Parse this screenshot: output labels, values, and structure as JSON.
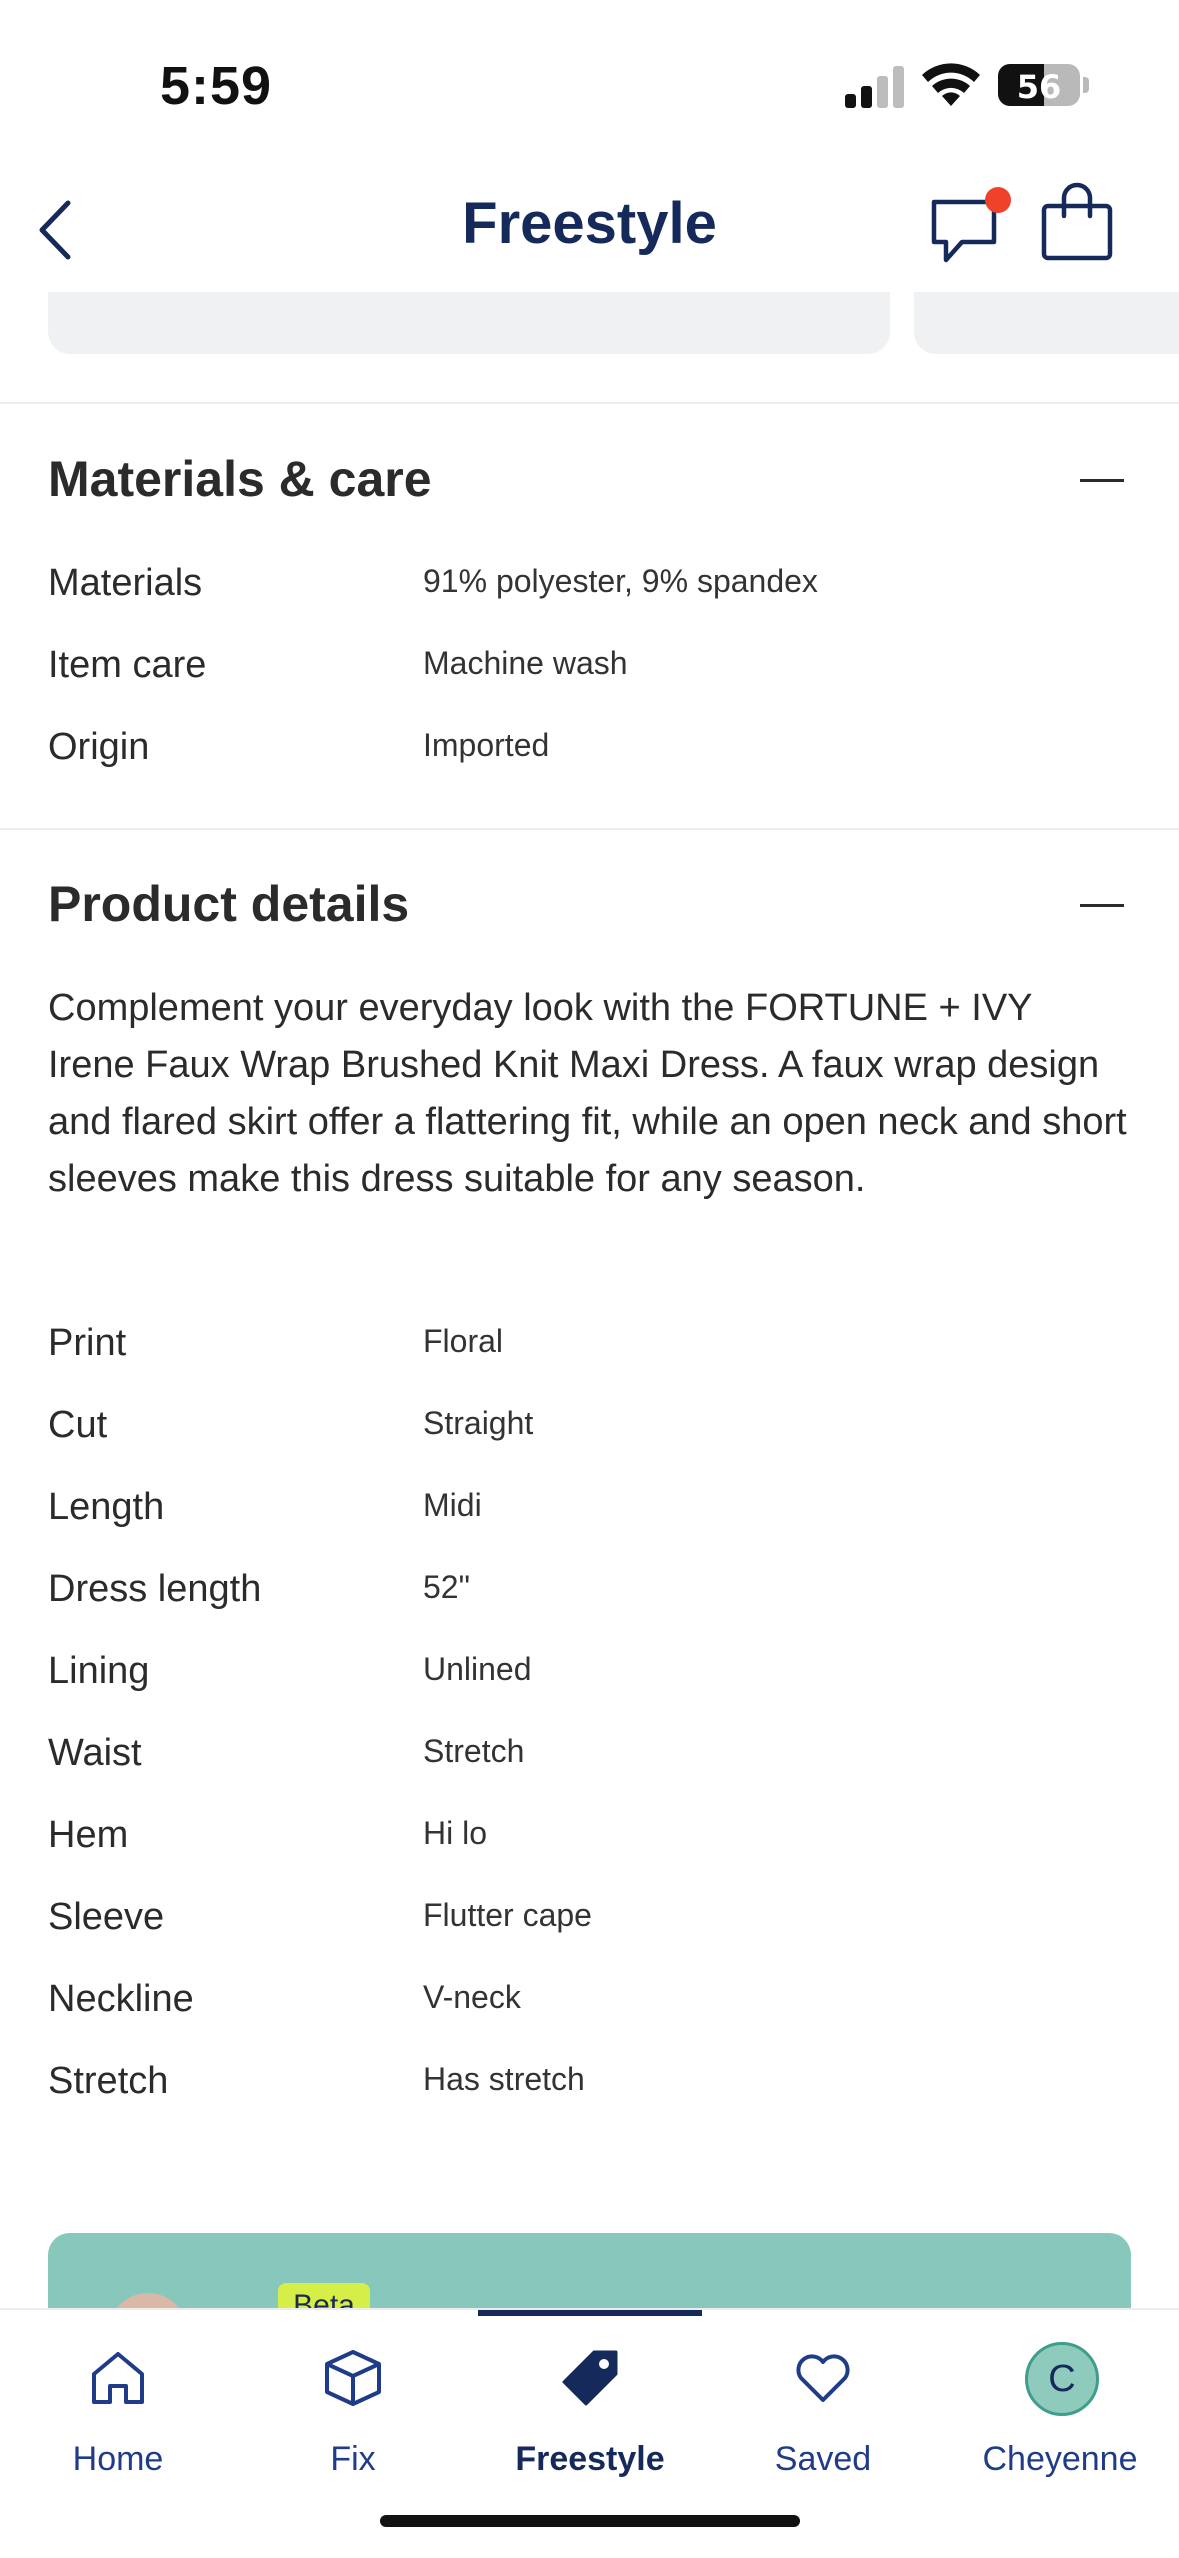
{
  "status_bar": {
    "time": "5:59",
    "battery": "56",
    "battery_level": 0.56
  },
  "header": {
    "title": "Freestyle"
  },
  "materials": {
    "title": "Materials & care",
    "rows": [
      {
        "label": "Materials",
        "value": "91% polyester, 9% spandex"
      },
      {
        "label": "Item care",
        "value": "Machine wash"
      },
      {
        "label": "Origin",
        "value": "Imported"
      }
    ]
  },
  "product_details": {
    "title": "Product details",
    "description": "Complement your everyday look with the FORTUNE + IVY Irene Faux Wrap Brushed Knit Maxi Dress. A faux wrap design and flared skirt offer a flattering fit, while an open neck and short sleeves make this dress suitable for any season.",
    "rows": [
      {
        "label": "Print",
        "value": "Floral"
      },
      {
        "label": "Cut",
        "value": "Straight"
      },
      {
        "label": "Length",
        "value": "Midi"
      },
      {
        "label": "Dress length",
        "value": "52\""
      },
      {
        "label": "Lining",
        "value": "Unlined"
      },
      {
        "label": "Waist",
        "value": "Stretch"
      },
      {
        "label": "Hem",
        "value": "Hi lo"
      },
      {
        "label": "Sleeve",
        "value": "Flutter cape"
      },
      {
        "label": "Neckline",
        "value": "V-neck"
      },
      {
        "label": "Stretch",
        "value": "Has stretch"
      }
    ]
  },
  "promo": {
    "badge": "Beta"
  },
  "nav": {
    "items": [
      {
        "label": "Home",
        "icon": "home-icon"
      },
      {
        "label": "Fix",
        "icon": "box-icon"
      },
      {
        "label": "Freestyle",
        "icon": "tag-icon",
        "active": true
      },
      {
        "label": "Saved",
        "icon": "heart-icon"
      },
      {
        "label": "Cheyenne",
        "icon": "avatar",
        "initial": "C"
      }
    ]
  },
  "colors": {
    "brand_navy": "#152a5a",
    "accent_teal": "#88c7bc",
    "notification_red": "#f0412b",
    "beta_yellow": "#d6ee48"
  }
}
